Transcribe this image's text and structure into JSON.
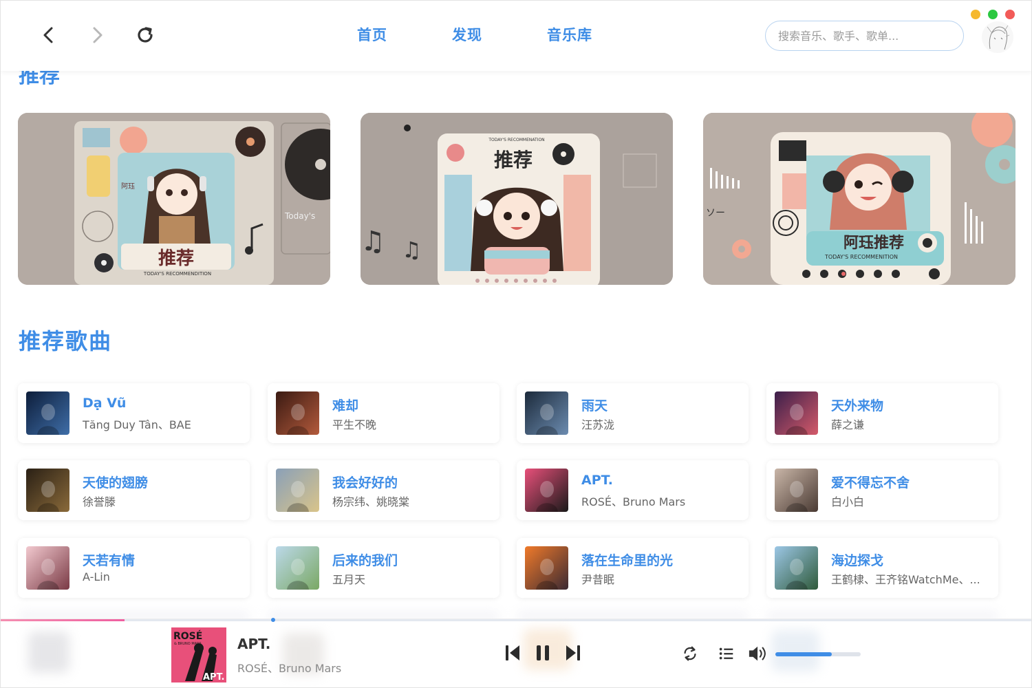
{
  "window": {
    "traffic_lights": {
      "minimize": "#f5b82e",
      "maximize": "#2bc840",
      "close": "#f25b58"
    }
  },
  "header": {
    "tabs": [
      {
        "label": "首页"
      },
      {
        "label": "发现"
      },
      {
        "label": "音乐库"
      }
    ],
    "search": {
      "placeholder": "搜索音乐、歌手、歌单..."
    },
    "accent_color": "#3f8de6"
  },
  "recommend": {
    "title_partial": "推荐",
    "banners": [
      {
        "text_main": "推荐",
        "text_sub": "TODAY'S RECOMMENDITION",
        "side_text": "Today's",
        "vertical_text": "阿珏"
      },
      {
        "text_main": "推荐",
        "text_sub": "TODAY'S RECOMMENATION"
      },
      {
        "text_main": "阿珏推荐",
        "text_sub": "TODAY'S RECOMMENITION",
        "side_text": "ソー"
      }
    ]
  },
  "songs_section": {
    "title": "推荐歌曲",
    "songs": [
      {
        "title": "Dạ Vũ",
        "artist": "Tăng Duy Tân、BAE",
        "cover_colors": [
          "#0d1d3a",
          "#3f6ea8"
        ]
      },
      {
        "title": "难却",
        "artist": "平生不晚",
        "cover_colors": [
          "#3a1a12",
          "#b35a3c"
        ]
      },
      {
        "title": "雨天",
        "artist": "汪苏泷",
        "cover_colors": [
          "#1c2a3b",
          "#6c8cb0"
        ]
      },
      {
        "title": "天外来物",
        "artist": "薛之谦",
        "cover_colors": [
          "#3b1f4a",
          "#d45a6a"
        ]
      },
      {
        "title": "天使的翅膀",
        "artist": "徐誉滕",
        "cover_colors": [
          "#2a2015",
          "#8a6a3a"
        ]
      },
      {
        "title": "我会好好的",
        "artist": "杨宗纬、姚晓棠",
        "cover_colors": [
          "#8aa0b8",
          "#d9c48a"
        ]
      },
      {
        "title": "APT.",
        "artist": "ROSÉ、Bruno Mars",
        "cover_colors": [
          "#e8507a",
          "#1a1a1a"
        ]
      },
      {
        "title": "爱不得忘不舍",
        "artist": "白小白",
        "cover_colors": [
          "#c9b6a8",
          "#4a3a33"
        ]
      },
      {
        "title": "天若有情",
        "artist": "A-Lin",
        "cover_colors": [
          "#f2c9cf",
          "#7a3a45"
        ]
      },
      {
        "title": "后来的我们",
        "artist": "五月天",
        "cover_colors": [
          "#bcd9ea",
          "#7aa864"
        ]
      },
      {
        "title": "落在生命里的光",
        "artist": "尹昔眠",
        "cover_colors": [
          "#f07a2a",
          "#3b2a33"
        ]
      },
      {
        "title": "海边探戈",
        "artist": "王鹤棣、王齐铭WatchMe、...",
        "cover_colors": [
          "#9cc7e6",
          "#2f5a3a"
        ]
      }
    ]
  },
  "player": {
    "title": "APT.",
    "artist": "ROSÉ、Bruno Mars",
    "cover_text": "ROSÉ",
    "cover_subtext": "& BRUNO MARS",
    "cover_badge": "APT.",
    "progress": 0.12,
    "volume": 0.66,
    "state": "playing"
  }
}
